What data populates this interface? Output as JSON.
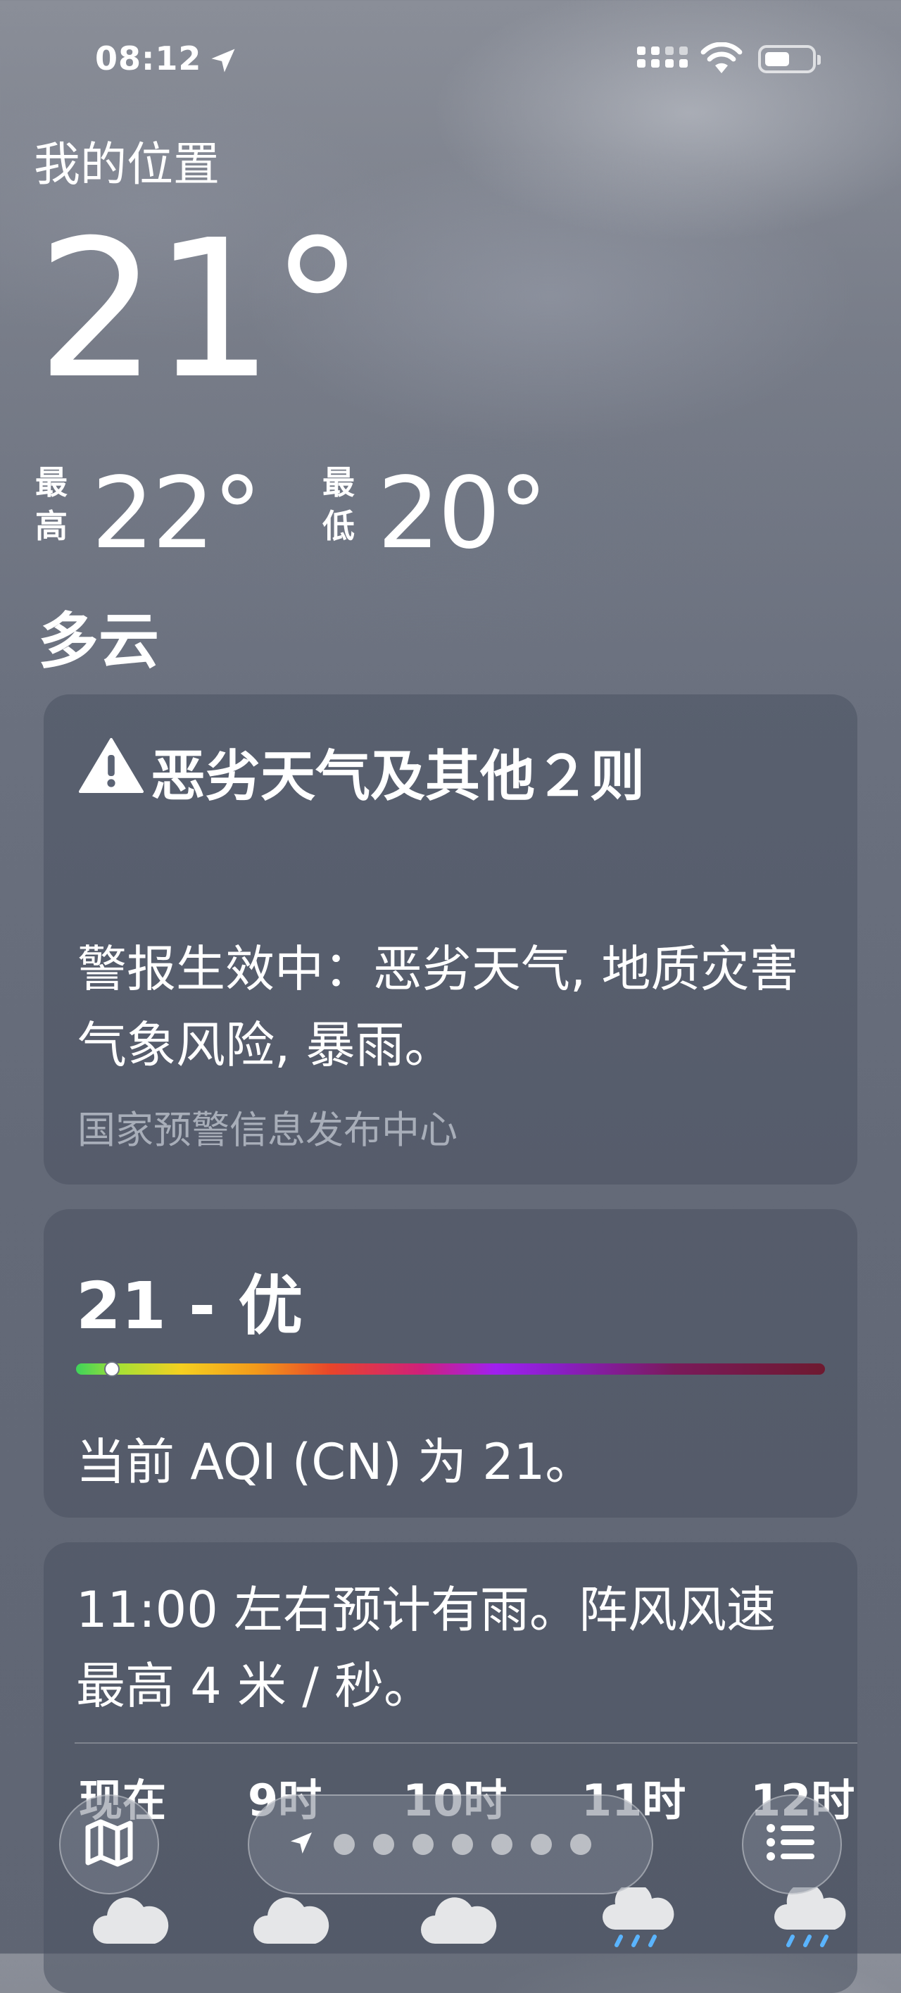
{
  "status_bar": {
    "time": "08:12"
  },
  "weather": {
    "location": "我的位置",
    "temperature": "21°",
    "high_label_1": "最",
    "high_label_2": "高",
    "high": "22°",
    "low_label_1": "最",
    "low_label_2": "低",
    "low": "20°",
    "condition": "多云"
  },
  "alert": {
    "title": "恶劣天气及其他２则",
    "body": "警报生效中：恶劣天气, 地质灾害气象风险, 暴雨。",
    "source": "国家预警信息发布中心"
  },
  "aqi": {
    "headline": "21 - 优",
    "value": 21,
    "description": "当前 AQI (CN) 为 21。"
  },
  "forecast": {
    "summary": "11:00 左右预计有雨。阵风风速最高 4 米 / 秒。",
    "hours": [
      "现在",
      "9时",
      "10时",
      "11时",
      "12时"
    ],
    "icons": [
      "cloud-icon",
      "cloud-icon",
      "cloud-icon",
      "cloud-rain-icon",
      "cloud-rain-icon"
    ]
  },
  "toolbar": {
    "map_icon": "map-icon",
    "list_icon": "list-icon",
    "page_count": 8,
    "current_page": 0
  }
}
